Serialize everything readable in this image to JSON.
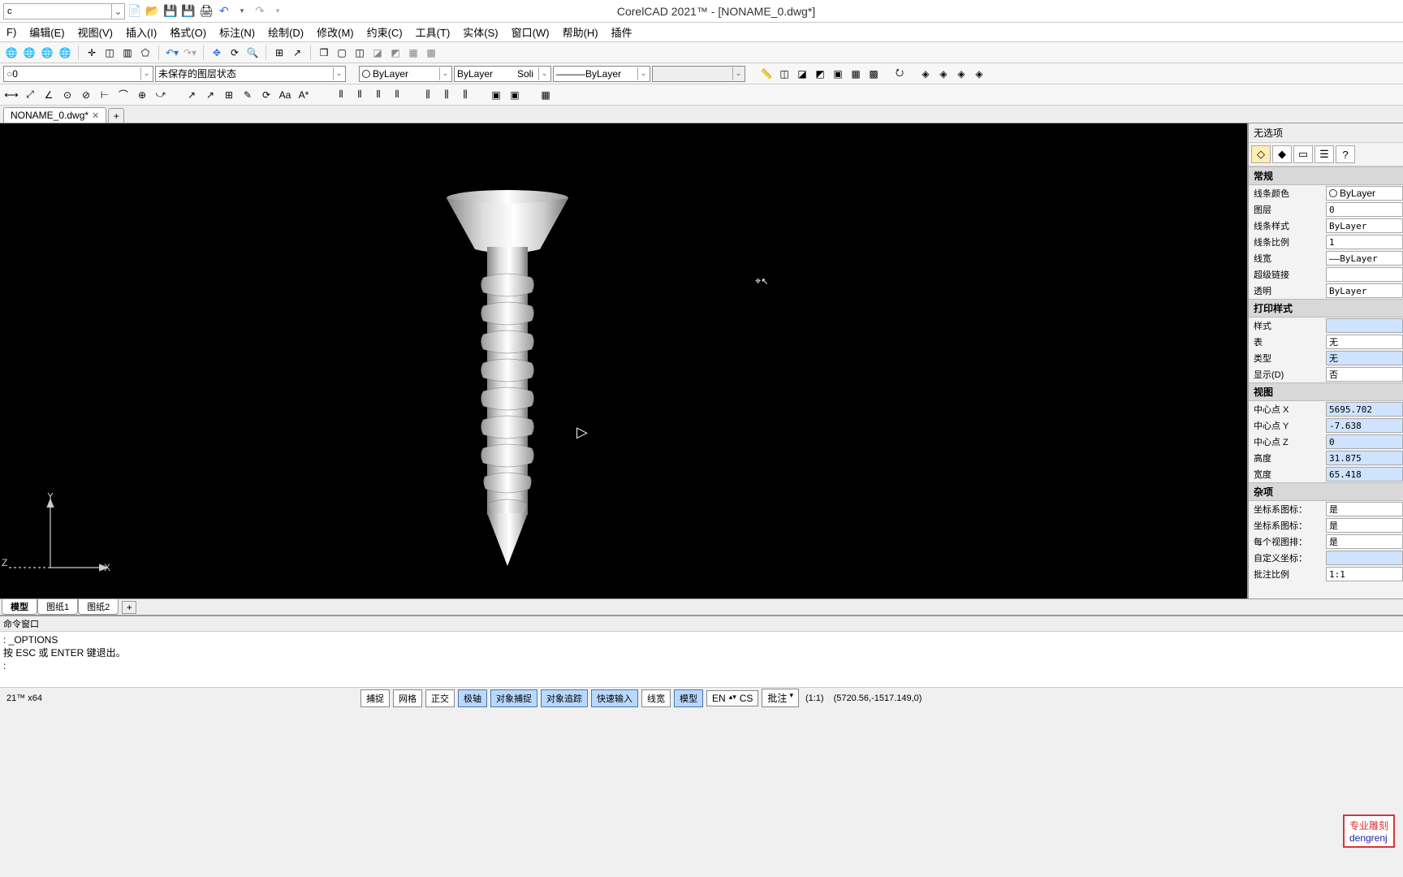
{
  "app": {
    "title": "CorelCAD 2021™ - [NONAME_0.dwg*]"
  },
  "qat": {
    "combo_value": "c"
  },
  "menu": {
    "file": "F)",
    "edit": "编辑(E)",
    "view": "视图(V)",
    "insert": "插入(I)",
    "format": "格式(O)",
    "dim": "标注(N)",
    "draw": "绘制(D)",
    "modify": "修改(M)",
    "constraint": "约束(C)",
    "tools": "工具(T)",
    "solid": "实体(S)",
    "window": "窗口(W)",
    "help": "帮助(H)",
    "plugins": "插件"
  },
  "layerbar": {
    "layer": "0",
    "layer_state": "未保存的图层状态",
    "color": "ByLayer",
    "ltype": "ByLayer",
    "lstyle": "Soli",
    "lw": "———ByLayer",
    "extra": ""
  },
  "tab": {
    "name": "NONAME_0.dwg*"
  },
  "sidepanel": {
    "header": "无选项",
    "sec_general": "常规",
    "linecolor_l": "线条颜色",
    "linecolor_v": "ByLayer",
    "layer_l": "图层",
    "layer_v": "0",
    "linestyle_l": "线条样式",
    "linestyle_v": "ByLayer",
    "linescale_l": "线条比例",
    "linescale_v": "1",
    "lineweight_l": "线宽",
    "lineweight_v": "——ByLayer",
    "hyperlink_l": "超级链接",
    "hyperlink_v": "",
    "transparency_l": "透明",
    "transparency_v": "ByLayer",
    "sec_plot": "打印样式",
    "style_l": "样式",
    "style_v": "",
    "table_l": "表",
    "table_v": "无",
    "type_l": "类型",
    "type_v": "无",
    "display_l": "显示(D)",
    "display_v": "否",
    "sec_view": "视图",
    "cx_l": "中心点 X",
    "cx_v": "5695.702",
    "cy_l": "中心点 Y",
    "cy_v": "-7.638",
    "cz_l": "中心点 Z",
    "cz_v": "0",
    "h_l": "高度",
    "h_v": "31.875",
    "w_l": "宽度",
    "w_v": "65.418",
    "sec_misc": "杂项",
    "ucsicon_l": "坐标系图标：",
    "ucsicon_v": "是",
    "ucsicon2_l": "坐标系图标：",
    "ucsicon2_v": "是",
    "pervp_l": "每个视图排：",
    "pervp_v": "是",
    "customcs_l": "自定义坐标：",
    "customcs_v": "",
    "annoscale_l": "批注比例",
    "annoscale_v": "1:1"
  },
  "layouts": {
    "model": "模型",
    "sheet1": "图纸1",
    "sheet2": "图纸2"
  },
  "cmd": {
    "title": "命令窗口",
    "line1": ": _OPTIONS",
    "line2": "",
    "line3": "按 ESC 或 ENTER 键退出。",
    "prompt": ":"
  },
  "status": {
    "left": "21™ x64",
    "snap": "捕捉",
    "grid": "网格",
    "ortho": "正交",
    "polar": "极轴",
    "osnap": "对象捕捉",
    "otrack": "对象追踪",
    "dyn": "快速输入",
    "lwt": "线宽",
    "model": "模型",
    "ime": "EN",
    "cs": "CS",
    "anno": "批注",
    "annoscale": "(1:1)",
    "coords": "(5720.56,-1517.149,0)"
  },
  "watermark": {
    "line1": "专业雕刻",
    "line2": "dengrenj"
  }
}
